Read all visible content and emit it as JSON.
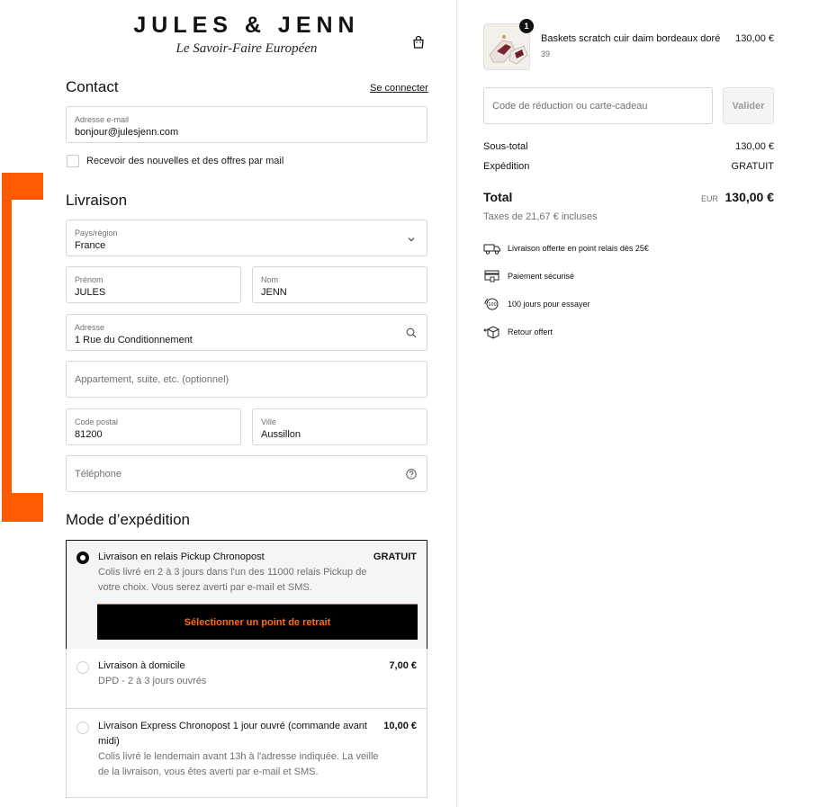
{
  "brand": {
    "name": "JULES & JENN",
    "tagline": "Le Savoir-Faire Européen"
  },
  "header": {
    "cart_icon": "shopping-bag-icon"
  },
  "contact": {
    "title": "Contact",
    "login_link": "Se connecter",
    "email_label": "Adresse e-mail",
    "email_value": "bonjour@julesjenn.com",
    "newsletter_label": "Recevoir des nouvelles et des offres par mail"
  },
  "livraison": {
    "title": "Livraison",
    "country_label": "Pays/région",
    "country_value": "France",
    "first_name_label": "Prénom",
    "first_name_value": "JULES",
    "last_name_label": "Nom",
    "last_name_value": "JENN",
    "address_label": "Adresse",
    "address_value": "1 Rue du Conditionnement",
    "apartment_placeholder": "Appartement, suite, etc. (optionnel)",
    "postal_label": "Code postal",
    "postal_value": "81200",
    "city_label": "Ville",
    "city_value": "Aussillon",
    "phone_placeholder": "Téléphone"
  },
  "shipping": {
    "title": "Mode d’expédition",
    "options": [
      {
        "title": "Livraison en relais Pickup Chronopost",
        "price": "GRATUIT",
        "desc_line1": "Colis livré en 2 à 3 jours dans l'un des 11000 relais Pickup de",
        "desc_line2": "votre choix. Vous serez averti par e-mail et SMS.",
        "button": "Sélectionner un point de retrait",
        "selected": true
      },
      {
        "title": "Livraison à domicile",
        "price": "7,00 €",
        "desc_line1": "DPD - 2 à 3 jours ouvrés",
        "selected": false
      },
      {
        "title_line1": "Livraison Express Chronopost 1 jour ouvré (commande avant",
        "title_line2": "midi)",
        "price": "10,00 €",
        "desc_line1": "Colis livré le lendemain avant 13h à l'adresse indiquée. La veille",
        "desc_line2": "de la livraison, vous êtes averti par e-mail et SMS.",
        "selected": false
      }
    ]
  },
  "summary": {
    "product": {
      "name": "Baskets scratch cuir daim bordeaux doré",
      "size": "39",
      "price": "130,00 €",
      "qty": "1"
    },
    "discount_placeholder": "Code de réduction ou carte-cadeau",
    "apply_button": "Valider",
    "subtotal_label": "Sous-total",
    "subtotal_value": "130,00 €",
    "shipping_label": "Expédition",
    "shipping_value": "GRATUIT",
    "total_label": "Total",
    "total_currency": "EUR",
    "total_value": "130,00 €",
    "tax_note": "Taxes de 21,67 € incluses",
    "perks": [
      {
        "icon": "truck-icon",
        "text": "Livraison offerte en point relais dès 25€"
      },
      {
        "icon": "card-payment-icon",
        "text": "Paiement sécurisé"
      },
      {
        "icon": "trial-days-icon",
        "text": "100 jours pour essayer"
      },
      {
        "icon": "return-box-icon",
        "text": "Retour offert"
      }
    ]
  },
  "colors": {
    "accent_orange": "#ff5a00",
    "button_bg": "#000000",
    "button_text": "#ff6a13"
  }
}
